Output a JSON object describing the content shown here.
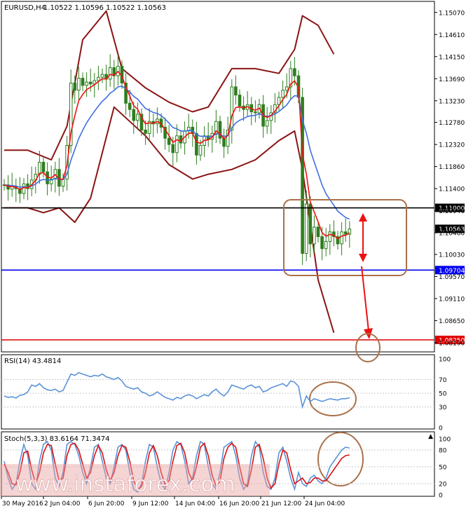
{
  "header": {
    "symbol_label": "EURUSD,H4",
    "ohlc": "1.10522 1.10596 1.10522 1.10563",
    "rsi_label": "RSI(14) 43.4814",
    "stoch_label": "Stoch(5,3,3) 83.6164 71.3474"
  },
  "watermark": "www.instaforex.com",
  "colors": {
    "candle": "#2e7d1e",
    "bollinger": "#8b1414",
    "fast_ma": "#ee1111",
    "slow_ma": "#3f6fe0",
    "oscillator": "#5b93d8",
    "signal": "#dd1111",
    "annotation": "#a9714a",
    "level_black": "#000000",
    "level_blue": "#0000ee",
    "level_red": "#dd0000"
  },
  "chart_data": [
    {
      "type": "candlestick",
      "symbol": "EURUSD",
      "timeframe": "H4",
      "ylim": [
        1.08,
        1.153
      ],
      "price_ticks": [
        "1.15070",
        "1.14610",
        "1.14150",
        "1.13690",
        "1.13230",
        "1.12780",
        "1.12320",
        "1.11860",
        "1.11400",
        "1.10940",
        "1.10480",
        "1.10030",
        "1.09570",
        "1.09110",
        "1.08650",
        "1.08190"
      ],
      "price_tick_values": [
        1.1507,
        1.1461,
        1.1415,
        1.1369,
        1.1323,
        1.1278,
        1.1232,
        1.1186,
        1.114,
        1.1094,
        1.1048,
        1.1003,
        1.0957,
        1.0911,
        1.0865,
        1.0819
      ],
      "x_labels": [
        "30 May 2016",
        "2 Jun 04:00",
        "6 Jun 20:00",
        "9 Jun 12:00",
        "14 Jun 04:00",
        "16 Jun 20:00",
        "21 Jun 12:00",
        "24 Jun 04:00"
      ],
      "levels": [
        {
          "label": "1.11000",
          "value": 1.11,
          "color": "#000000"
        },
        {
          "label": "1.09704",
          "value": 1.09704,
          "color": "#0000ee"
        },
        {
          "label": "1.08250",
          "value": 1.0825,
          "color": "#dd0000"
        }
      ],
      "current_price": {
        "label": "1.10563",
        "value": 1.10563
      },
      "close_series": [
        1.1148,
        1.1139,
        1.1145,
        1.114,
        1.113,
        1.115,
        1.114,
        1.1158,
        1.117,
        1.1195,
        1.1175,
        1.115,
        1.116,
        1.118,
        1.1145,
        1.116,
        1.123,
        1.136,
        1.1345,
        1.137,
        1.1355,
        1.1362,
        1.1358,
        1.1365,
        1.1372,
        1.1378,
        1.1368,
        1.1392,
        1.1375,
        1.1395,
        1.136,
        1.1318,
        1.1305,
        1.1282,
        1.1295,
        1.1262,
        1.1255,
        1.128,
        1.1275,
        1.1285,
        1.1268,
        1.1245,
        1.1232,
        1.1215,
        1.125,
        1.1235,
        1.126,
        1.1268,
        1.1255,
        1.121,
        1.123,
        1.125,
        1.1243,
        1.1255,
        1.128,
        1.1245,
        1.1228,
        1.1262,
        1.1352,
        1.1335,
        1.1312,
        1.1305,
        1.1315,
        1.13,
        1.1298,
        1.1315,
        1.127,
        1.1282,
        1.1298,
        1.1315,
        1.133,
        1.1345,
        1.1352,
        1.139,
        1.1375,
        1.133,
        1.1005,
        1.1108,
        1.1025,
        1.106,
        1.104,
        1.1015,
        1.103,
        1.105,
        1.104,
        1.1025,
        1.105,
        1.1045,
        1.1056
      ],
      "bollinger_upper": [
        [
          0,
          1.122
        ],
        [
          6,
          1.122
        ],
        [
          12,
          1.12
        ],
        [
          16,
          1.127
        ],
        [
          20,
          1.145
        ],
        [
          26,
          1.151
        ],
        [
          30,
          1.139
        ],
        [
          36,
          1.135
        ],
        [
          42,
          1.132
        ],
        [
          48,
          1.13
        ],
        [
          52,
          1.131
        ],
        [
          58,
          1.139
        ],
        [
          64,
          1.139
        ],
        [
          70,
          1.138
        ],
        [
          74,
          1.143
        ],
        [
          76,
          1.15
        ],
        [
          80,
          1.148
        ],
        [
          84,
          1.142
        ]
      ],
      "bollinger_lower": [
        [
          0,
          1.11
        ],
        [
          6,
          1.11
        ],
        [
          10,
          1.109
        ],
        [
          14,
          1.11
        ],
        [
          18,
          1.107
        ],
        [
          22,
          1.112
        ],
        [
          28,
          1.131
        ],
        [
          36,
          1.125
        ],
        [
          42,
          1.119
        ],
        [
          48,
          1.116
        ],
        [
          52,
          1.117
        ],
        [
          58,
          1.118
        ],
        [
          64,
          1.12
        ],
        [
          70,
          1.124
        ],
        [
          74,
          1.126
        ],
        [
          76,
          1.118
        ],
        [
          80,
          1.095
        ],
        [
          84,
          1.084
        ]
      ],
      "annotations": [
        "range-box",
        "double-arrow",
        "down-arrow",
        "target-circle"
      ]
    },
    {
      "type": "line",
      "title": "RSI(14) 43.4814",
      "ylim": [
        0,
        100
      ],
      "ticks": [
        "100",
        "70",
        "50",
        "30",
        "0"
      ],
      "tick_values": [
        100,
        70,
        50,
        30,
        0
      ],
      "series": [
        {
          "values": [
            46,
            44,
            45,
            43,
            47,
            48,
            52,
            62,
            60,
            64,
            58,
            55,
            54,
            56,
            52,
            54,
            66,
            78,
            76,
            80,
            78,
            76,
            74,
            76,
            75,
            78,
            74,
            72,
            70,
            73,
            68,
            60,
            58,
            56,
            58,
            52,
            50,
            46,
            48,
            52,
            48,
            44,
            42,
            40,
            44,
            42,
            46,
            48,
            46,
            42,
            45,
            48,
            46,
            52,
            56,
            50,
            46,
            52,
            62,
            60,
            58,
            56,
            60,
            62,
            58,
            60,
            52,
            54,
            58,
            60,
            62,
            64,
            60,
            68,
            66,
            60,
            30,
            46,
            38,
            42,
            40,
            38,
            40,
            42,
            41,
            40,
            42,
            42,
            43.5
          ]
        }
      ]
    },
    {
      "type": "line",
      "title": "Stoch(5,3,3) 83.6164 71.3474",
      "ylim": [
        0,
        100
      ],
      "ticks": [
        "100",
        "80",
        "50",
        "20",
        "0"
      ],
      "tick_values": [
        100,
        80,
        50,
        20,
        0
      ],
      "series": [
        {
          "name": "main",
          "values": [
            60,
            30,
            10,
            20,
            60,
            90,
            70,
            20,
            10,
            60,
            90,
            95,
            80,
            30,
            15,
            40,
            90,
            95,
            90,
            70,
            40,
            20,
            50,
            85,
            90,
            60,
            30,
            20,
            50,
            85,
            90,
            80,
            40,
            10,
            5,
            20,
            60,
            90,
            85,
            50,
            20,
            10,
            40,
            80,
            95,
            90,
            60,
            20,
            30,
            70,
            95,
            90,
            50,
            20,
            10,
            40,
            85,
            90,
            95,
            70,
            30,
            10,
            20,
            70,
            95,
            85,
            40,
            15,
            10,
            30,
            75,
            85,
            60,
            30,
            10,
            40,
            20,
            15,
            30,
            35,
            25,
            20,
            30,
            50,
            60,
            70,
            80,
            85,
            83.6
          ]
        },
        {
          "name": "signal",
          "values": [
            55,
            40,
            20,
            18,
            40,
            75,
            78,
            45,
            20,
            40,
            75,
            90,
            88,
            55,
            25,
            30,
            70,
            90,
            92,
            80,
            55,
            30,
            40,
            70,
            88,
            75,
            45,
            25,
            40,
            70,
            88,
            85,
            60,
            25,
            10,
            15,
            40,
            75,
            88,
            70,
            40,
            18,
            25,
            60,
            88,
            92,
            75,
            40,
            25,
            50,
            85,
            92,
            70,
            35,
            15,
            25,
            65,
            85,
            92,
            85,
            50,
            20,
            15,
            45,
            85,
            90,
            65,
            30,
            12,
            20,
            55,
            80,
            75,
            45,
            20,
            25,
            30,
            20,
            22,
            30,
            30,
            25,
            25,
            35,
            45,
            55,
            65,
            70,
            71.3
          ]
        }
      ]
    }
  ]
}
